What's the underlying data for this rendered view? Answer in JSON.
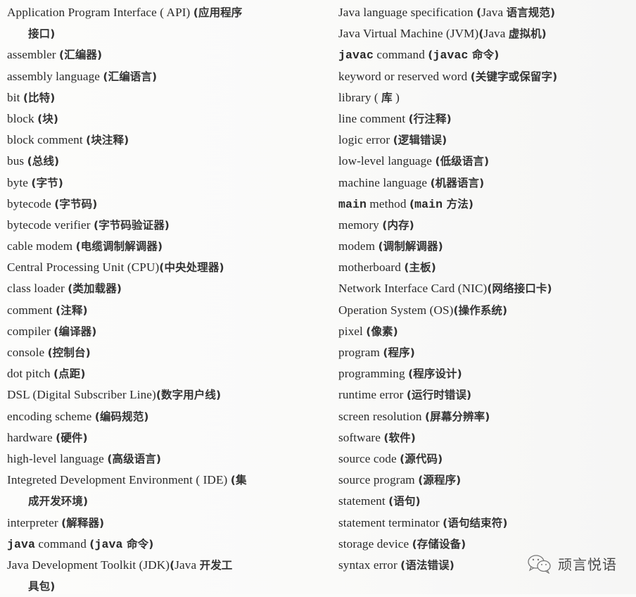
{
  "glossary": {
    "left_column": [
      {
        "parts": [
          {
            "t": "Application Program Interface ( API) ",
            "k": "en"
          },
          {
            "t": "(应用程序",
            "k": "zh"
          }
        ]
      },
      {
        "indent": true,
        "parts": [
          {
            "t": "接口)",
            "k": "zh"
          }
        ]
      },
      {
        "parts": [
          {
            "t": "assembler ",
            "k": "en"
          },
          {
            "t": "(汇编器)",
            "k": "zh"
          }
        ]
      },
      {
        "parts": [
          {
            "t": "assembly language ",
            "k": "en"
          },
          {
            "t": "(汇编语言)",
            "k": "zh"
          }
        ]
      },
      {
        "parts": [
          {
            "t": "bit ",
            "k": "en"
          },
          {
            "t": "(比特)",
            "k": "zh"
          }
        ]
      },
      {
        "parts": [
          {
            "t": "block ",
            "k": "en"
          },
          {
            "t": "(块)",
            "k": "zh"
          }
        ]
      },
      {
        "parts": [
          {
            "t": "block comment ",
            "k": "en"
          },
          {
            "t": "(块注释)",
            "k": "zh"
          }
        ]
      },
      {
        "parts": [
          {
            "t": "bus ",
            "k": "en"
          },
          {
            "t": "(总线)",
            "k": "zh"
          }
        ]
      },
      {
        "parts": [
          {
            "t": "byte ",
            "k": "en"
          },
          {
            "t": "(字节)",
            "k": "zh"
          }
        ]
      },
      {
        "parts": [
          {
            "t": "bytecode ",
            "k": "en"
          },
          {
            "t": "(字节码)",
            "k": "zh"
          }
        ]
      },
      {
        "parts": [
          {
            "t": "bytecode verifier ",
            "k": "en"
          },
          {
            "t": "(字节码验证器)",
            "k": "zh"
          }
        ]
      },
      {
        "parts": [
          {
            "t": "cable modem ",
            "k": "en"
          },
          {
            "t": "(电缆调制解调器)",
            "k": "zh"
          }
        ]
      },
      {
        "parts": [
          {
            "t": "Central Processing Unit (CPU)",
            "k": "en"
          },
          {
            "t": "(中央处理器)",
            "k": "zh"
          }
        ]
      },
      {
        "parts": [
          {
            "t": "class loader ",
            "k": "en"
          },
          {
            "t": "(类加载器)",
            "k": "zh"
          }
        ]
      },
      {
        "parts": [
          {
            "t": "comment ",
            "k": "en"
          },
          {
            "t": "(注释)",
            "k": "zh"
          }
        ]
      },
      {
        "parts": [
          {
            "t": "compiler ",
            "k": "en"
          },
          {
            "t": "(编译器)",
            "k": "zh"
          }
        ]
      },
      {
        "parts": [
          {
            "t": "console ",
            "k": "en"
          },
          {
            "t": "(控制台)",
            "k": "zh"
          }
        ]
      },
      {
        "parts": [
          {
            "t": "dot pitch ",
            "k": "en"
          },
          {
            "t": "(点距)",
            "k": "zh"
          }
        ]
      },
      {
        "parts": [
          {
            "t": "DSL (Digital Subscriber Line)",
            "k": "en"
          },
          {
            "t": "(数字用户线)",
            "k": "zh"
          }
        ]
      },
      {
        "parts": [
          {
            "t": "encoding scheme ",
            "k": "en"
          },
          {
            "t": "(编码规范)",
            "k": "zh"
          }
        ]
      },
      {
        "parts": [
          {
            "t": "hardware ",
            "k": "en"
          },
          {
            "t": "(硬件)",
            "k": "zh"
          }
        ]
      },
      {
        "parts": [
          {
            "t": "high-level language ",
            "k": "en"
          },
          {
            "t": "(高级语言)",
            "k": "zh"
          }
        ]
      },
      {
        "parts": [
          {
            "t": "Integreted Development Environment ( IDE) ",
            "k": "en"
          },
          {
            "t": "(集",
            "k": "zh"
          }
        ]
      },
      {
        "indent": true,
        "parts": [
          {
            "t": "成开发环境)",
            "k": "zh"
          }
        ]
      },
      {
        "parts": [
          {
            "t": "interpreter ",
            "k": "en"
          },
          {
            "t": "(解释器)",
            "k": "zh"
          }
        ]
      },
      {
        "parts": [
          {
            "t": "java",
            "k": "mono"
          },
          {
            "t": " command ",
            "k": "en"
          },
          {
            "t": "(",
            "k": "zh"
          },
          {
            "t": "java",
            "k": "mono"
          },
          {
            "t": " 命令)",
            "k": "zh"
          }
        ]
      },
      {
        "parts": [
          {
            "t": "Java Development Toolkit (JDK)",
            "k": "en"
          },
          {
            "t": "(",
            "k": "zh"
          },
          {
            "t": "Java ",
            "k": "en"
          },
          {
            "t": "开发工",
            "k": "zh"
          }
        ]
      },
      {
        "indent": true,
        "parts": [
          {
            "t": "具包)",
            "k": "zh"
          }
        ]
      }
    ],
    "right_column": [
      {
        "parts": [
          {
            "t": "Java language specification ",
            "k": "en"
          },
          {
            "t": "(",
            "k": "zh"
          },
          {
            "t": "Java ",
            "k": "en"
          },
          {
            "t": "语言规范)",
            "k": "zh"
          }
        ]
      },
      {
        "parts": [
          {
            "t": "Java Virtual Machine (JVM)",
            "k": "en"
          },
          {
            "t": "(",
            "k": "zh"
          },
          {
            "t": "Java ",
            "k": "en"
          },
          {
            "t": "虚拟机)",
            "k": "zh"
          }
        ]
      },
      {
        "parts": [
          {
            "t": "javac",
            "k": "mono"
          },
          {
            "t": " command ",
            "k": "en"
          },
          {
            "t": "(",
            "k": "zh"
          },
          {
            "t": "javac",
            "k": "mono"
          },
          {
            "t": " 命令)",
            "k": "zh"
          }
        ]
      },
      {
        "parts": [
          {
            "t": "keyword or reserved word ",
            "k": "en"
          },
          {
            "t": "(关键字或保留字)",
            "k": "zh"
          }
        ]
      },
      {
        "parts": [
          {
            "t": "library ( ",
            "k": "en"
          },
          {
            "t": "库",
            "k": "zh"
          },
          {
            "t": " )",
            "k": "en"
          }
        ]
      },
      {
        "parts": [
          {
            "t": "line comment ",
            "k": "en"
          },
          {
            "t": "(行注释)",
            "k": "zh"
          }
        ]
      },
      {
        "parts": [
          {
            "t": "logic error ",
            "k": "en"
          },
          {
            "t": "(逻辑错误)",
            "k": "zh"
          }
        ]
      },
      {
        "parts": [
          {
            "t": "low-level language ",
            "k": "en"
          },
          {
            "t": "(低级语言)",
            "k": "zh"
          }
        ]
      },
      {
        "parts": [
          {
            "t": "machine language ",
            "k": "en"
          },
          {
            "t": "(机器语言)",
            "k": "zh"
          }
        ]
      },
      {
        "parts": [
          {
            "t": "main",
            "k": "mono"
          },
          {
            "t": " method ",
            "k": "en"
          },
          {
            "t": "(",
            "k": "zh"
          },
          {
            "t": "main",
            "k": "mono"
          },
          {
            "t": " 方法)",
            "k": "zh"
          }
        ]
      },
      {
        "parts": [
          {
            "t": "memory ",
            "k": "en"
          },
          {
            "t": "(内存)",
            "k": "zh"
          }
        ]
      },
      {
        "parts": [
          {
            "t": "modem ",
            "k": "en"
          },
          {
            "t": "(调制解调器)",
            "k": "zh"
          }
        ]
      },
      {
        "parts": [
          {
            "t": "motherboard ",
            "k": "en"
          },
          {
            "t": "(主板)",
            "k": "zh"
          }
        ]
      },
      {
        "parts": [
          {
            "t": "Network Interface Card (NIC)",
            "k": "en"
          },
          {
            "t": "(网络接口卡)",
            "k": "zh"
          }
        ]
      },
      {
        "parts": [
          {
            "t": "Operation System (OS)",
            "k": "en"
          },
          {
            "t": "(操作系统)",
            "k": "zh"
          }
        ]
      },
      {
        "parts": [
          {
            "t": "pixel ",
            "k": "en"
          },
          {
            "t": "(像素)",
            "k": "zh"
          }
        ]
      },
      {
        "parts": [
          {
            "t": "program ",
            "k": "en"
          },
          {
            "t": "(程序)",
            "k": "zh"
          }
        ]
      },
      {
        "parts": [
          {
            "t": "programming ",
            "k": "en"
          },
          {
            "t": "(程序设计)",
            "k": "zh"
          }
        ]
      },
      {
        "parts": [
          {
            "t": "runtime error ",
            "k": "en"
          },
          {
            "t": "(运行时错误)",
            "k": "zh"
          }
        ]
      },
      {
        "parts": [
          {
            "t": "screen resolution ",
            "k": "en"
          },
          {
            "t": "(屏幕分辨率)",
            "k": "zh"
          }
        ]
      },
      {
        "parts": [
          {
            "t": "software ",
            "k": "en"
          },
          {
            "t": "(软件)",
            "k": "zh"
          }
        ]
      },
      {
        "parts": [
          {
            "t": "source code ",
            "k": "en"
          },
          {
            "t": "(源代码)",
            "k": "zh"
          }
        ]
      },
      {
        "parts": [
          {
            "t": "source program ",
            "k": "en"
          },
          {
            "t": "(源程序)",
            "k": "zh"
          }
        ]
      },
      {
        "parts": [
          {
            "t": "statement ",
            "k": "en"
          },
          {
            "t": "(语句)",
            "k": "zh"
          }
        ]
      },
      {
        "parts": [
          {
            "t": "statement terminator ",
            "k": "en"
          },
          {
            "t": "(语句结束符)",
            "k": "zh"
          }
        ]
      },
      {
        "parts": [
          {
            "t": "storage device ",
            "k": "en"
          },
          {
            "t": "(存储设备)",
            "k": "zh"
          }
        ]
      },
      {
        "parts": [
          {
            "t": "syntax error ",
            "k": "en"
          },
          {
            "t": "(语法错误)",
            "k": "zh"
          }
        ]
      }
    ]
  },
  "watermark": {
    "icon": "wechat-icon",
    "text": "顽言悦语"
  }
}
